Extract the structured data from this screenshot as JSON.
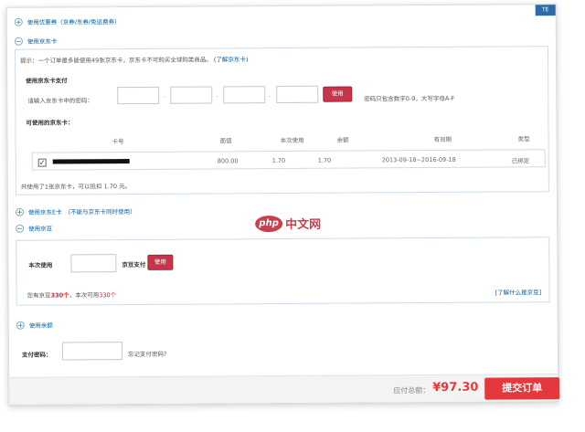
{
  "panel": {
    "corner_label": "TE"
  },
  "sections": {
    "coupon": {
      "title": "使用优惠券（京券/东券/免运费券）"
    },
    "jd_card": {
      "title": "使用京东卡"
    },
    "e_card": {
      "title": "使用京东E卡",
      "note": "（不能与京东卡同时使用）"
    },
    "beans": {
      "title": "使用京豆"
    },
    "balance": {
      "title": "使用余额"
    }
  },
  "jd_card": {
    "hint": "提示：一个订单最多能使用49张京东卡，京东卡不可购买全球购类商品。",
    "hint_link": "(了解京东卡)",
    "pay_label": "使用京东卡支付",
    "pw_prompt": "请输入京东卡中的密码：",
    "use_button": "使用",
    "pw_tip": "密码只包含数字0-9，大写字母A-F",
    "available_label": "可使用的京东卡：",
    "table": {
      "headers": [
        "卡号",
        "面值",
        "本次使用",
        "余额",
        "有效期",
        "类型"
      ],
      "row": {
        "face": "800.00",
        "use": "1.70",
        "balance": "1.70",
        "validity": "2013-09-18~2016-09-18",
        "type": "已绑定",
        "checked": true
      }
    },
    "total_text": "共使用了1张京东卡，可以抵扣 1.70 元。"
  },
  "beans": {
    "use_label": "本次使用",
    "pay_label": "京豆支付",
    "use_button": "使用",
    "info_prefix": "您有京豆",
    "info_total": "330个",
    "info_mid": "，本次可用",
    "info_avail": "330个",
    "link": "[了解什么是京豆]"
  },
  "payment": {
    "password_label": "支付密码：",
    "forgot": "忘记支付密码？"
  },
  "footer": {
    "due_label": "应付总额：",
    "due_amount": "¥97.30",
    "submit": "提交订单"
  },
  "watermark": {
    "logo": "php",
    "text": "中文网"
  },
  "colors": {
    "link": "#005ea7",
    "accent": "#e4393c",
    "button_red": "#c7354a"
  }
}
